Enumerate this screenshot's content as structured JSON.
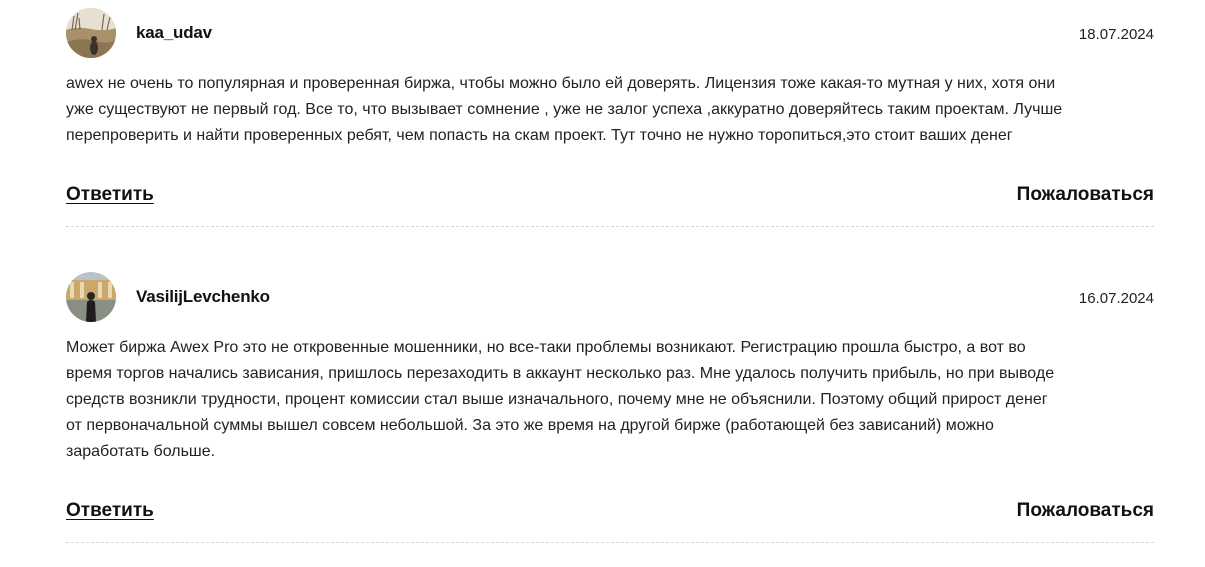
{
  "comments": [
    {
      "author": "kaa_udav",
      "date": "18.07.2024",
      "text": "awex не очень то популярная и проверенная биржа, чтобы можно было ей доверять. Лицензия тоже какая-то мутная у них, хотя они\nуже существуют не первый год. Все то, что вызывает сомнение , уже не залог успеха ,аккуратно доверяйтесь таким проектам. Лучше\nперепроверить и найти проверенных ребят, чем попасть на скам проект. Тут точно не нужно торопиться,это стоит ваших денег",
      "reply_label": "Ответить",
      "complain_label": "Пожаловаться"
    },
    {
      "author": "VasilijLevchenko",
      "date": "16.07.2024",
      "text": "Может биржа Awex Pro это не откровенные мошенники, но все-таки проблемы возникают. Регистрацию прошла быстро, а вот во\nвремя торгов начались зависания, пришлось перезаходить в аккаунт несколько раз. Мне удалось получить прибыль, но при выводе\nсредств возникли трудности, процент комиссии стал выше изначального, почему мне не объяснили. Поэтому общий прирост денег\nот первоначальной суммы вышел совсем небольшой. За это же время на другой бирже (работающей без зависаний) можно\nзаработать больше.",
      "reply_label": "Ответить",
      "complain_label": "Пожаловаться"
    }
  ]
}
